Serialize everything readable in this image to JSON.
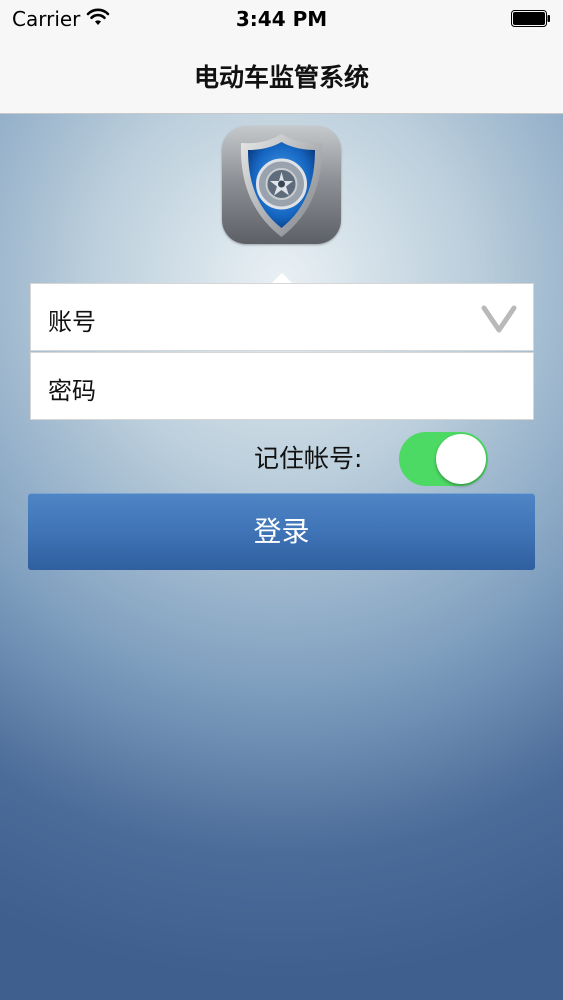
{
  "status_bar": {
    "carrier": "Carrier",
    "time": "3:44 PM"
  },
  "nav": {
    "title": "电动车监管系统"
  },
  "form": {
    "account_placeholder": "账号",
    "password_placeholder": "密码",
    "remember_label": "记住帐号:",
    "remember_on": true,
    "login_label": "登录"
  },
  "colors": {
    "toggle_on": "#4cd964",
    "login_button": "#3f74b7"
  },
  "icons": {
    "logo": "shield-wheel-logo-icon",
    "dropdown": "chevron-down-icon",
    "wifi": "wifi-icon",
    "battery": "battery-icon"
  }
}
